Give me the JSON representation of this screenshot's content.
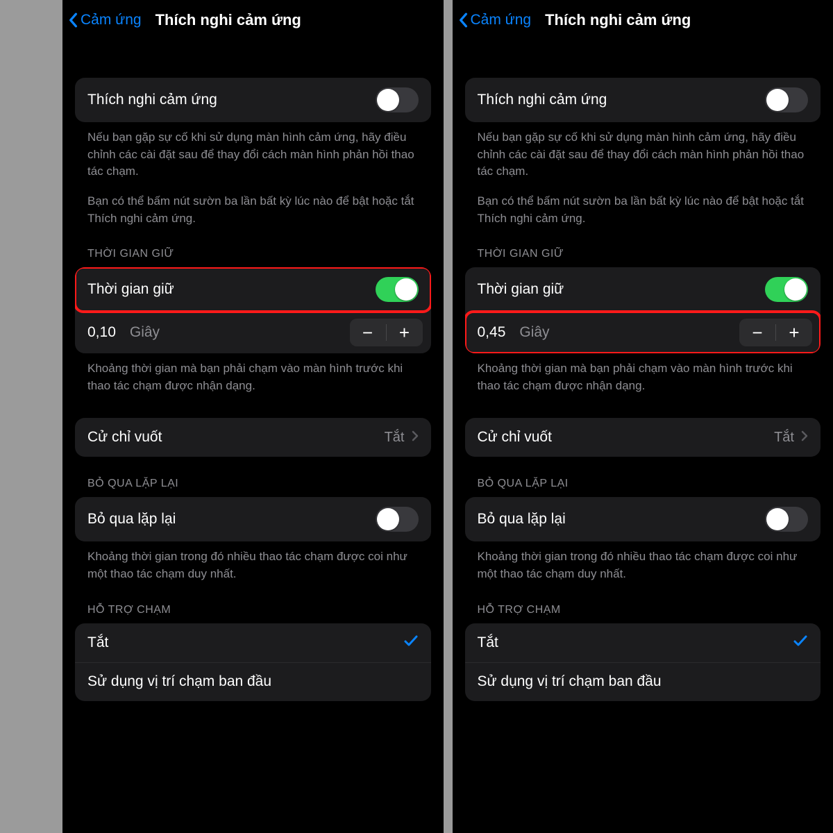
{
  "screens": [
    {
      "nav": {
        "back": "Cảm ứng",
        "title": "Thích nghi cảm ứng"
      },
      "main_toggle": {
        "label": "Thích nghi cảm ứng",
        "on": false
      },
      "desc1": "Nếu bạn gặp sự cố khi sử dụng màn hình cảm ứng, hãy điều chỉnh các cài đặt sau để thay đổi cách màn hình phản hồi thao tác chạm.",
      "desc2": "Bạn có thể bấm nút sườn ba lần bất kỳ lúc nào để bật hoặc tắt Thích nghi cảm ứng.",
      "hold": {
        "header": "THỜI GIAN GIỮ",
        "label": "Thời gian giữ",
        "on": true,
        "value": "0,10",
        "unit": "Giây",
        "footer": "Khoảng thời gian mà bạn phải chạm vào màn hình trước khi thao tác chạm được nhận dạng.",
        "highlight": "toggle"
      },
      "swipe": {
        "label": "Cử chỉ vuốt",
        "value": "Tắt"
      },
      "ignore": {
        "header": "BỎ QUA LẶP LẠI",
        "label": "Bỏ qua lặp lại",
        "on": false,
        "footer": "Khoảng thời gian trong đó nhiều thao tác chạm được coi như một thao tác chạm duy nhất."
      },
      "assist": {
        "header": "HỖ TRỢ CHẠM",
        "off_label": "Tắt",
        "initial_label": "Sử dụng vị trí chạm ban đầu"
      }
    },
    {
      "nav": {
        "back": "Cảm ứng",
        "title": "Thích nghi cảm ứng"
      },
      "main_toggle": {
        "label": "Thích nghi cảm ứng",
        "on": false
      },
      "desc1": "Nếu bạn gặp sự cố khi sử dụng màn hình cảm ứng, hãy điều chỉnh các cài đặt sau để thay đổi cách màn hình phản hồi thao tác chạm.",
      "desc2": "Bạn có thể bấm nút sườn ba lần bất kỳ lúc nào để bật hoặc tắt Thích nghi cảm ứng.",
      "hold": {
        "header": "THỜI GIAN GIỮ",
        "label": "Thời gian giữ",
        "on": true,
        "value": "0,45",
        "unit": "Giây",
        "footer": "Khoảng thời gian mà bạn phải chạm vào màn hình trước khi thao tác chạm được nhận dạng.",
        "highlight": "duration"
      },
      "swipe": {
        "label": "Cử chỉ vuốt",
        "value": "Tắt"
      },
      "ignore": {
        "header": "BỎ QUA LẶP LẠI",
        "label": "Bỏ qua lặp lại",
        "on": false,
        "footer": "Khoảng thời gian trong đó nhiều thao tác chạm được coi như một thao tác chạm duy nhất."
      },
      "assist": {
        "header": "HỖ TRỢ CHẠM",
        "off_label": "Tắt",
        "initial_label": "Sử dụng vị trí chạm ban đầu"
      }
    }
  ]
}
